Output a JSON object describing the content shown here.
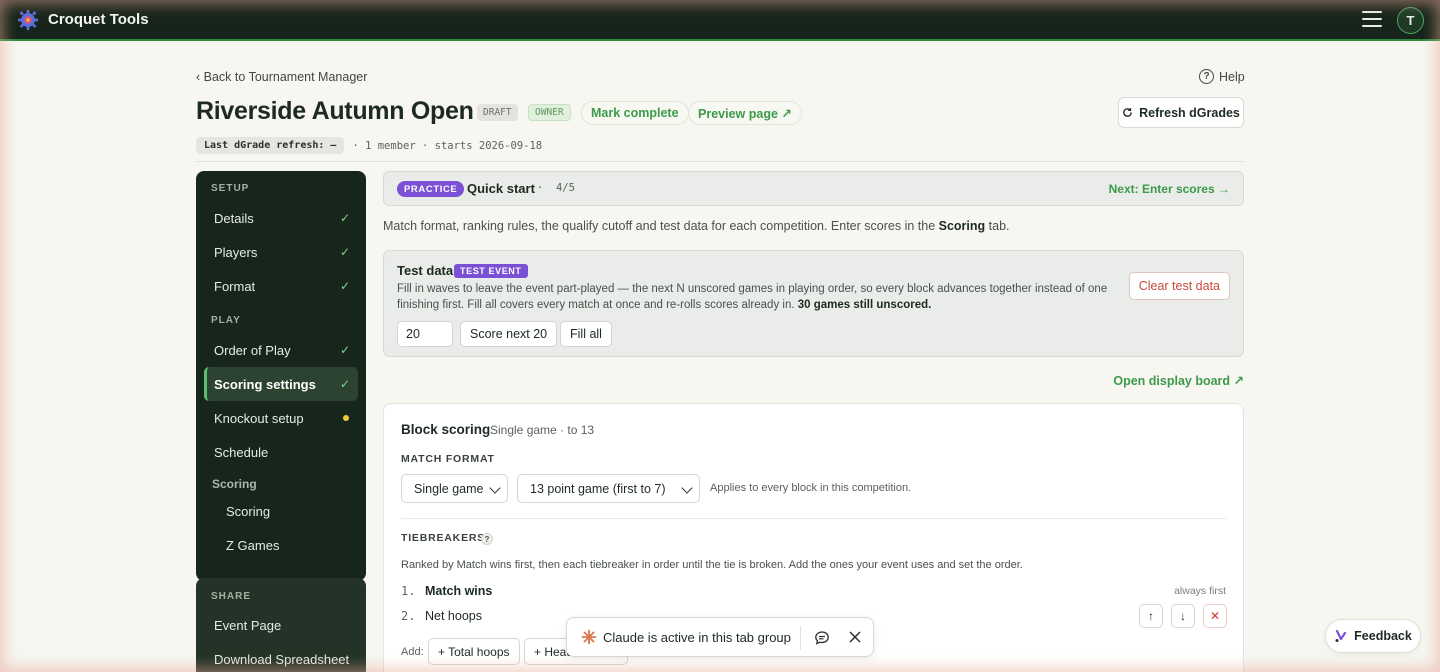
{
  "app": {
    "title": "Croquet Tools",
    "avatar_initial": "T"
  },
  "header": {
    "back_link": "‹ Back to Tournament Manager",
    "help": "Help",
    "title": "Riverside Autumn Open",
    "badge_draft": "DRAFT",
    "badge_owner": "OWNER",
    "mark_complete": "Mark complete",
    "preview_page": "Preview page ↗",
    "refresh_button": "Refresh dGrades",
    "meta_chip": "Last dGrade refresh: —",
    "meta_text": "· 1 member · starts 2026-09-18"
  },
  "sidebar": {
    "setup_label": "SETUP",
    "play_label": "PLAY",
    "share_label": "SHARE",
    "items": [
      {
        "label": "Details",
        "status": "✓"
      },
      {
        "label": "Players",
        "status": "✓"
      },
      {
        "label": "Format",
        "status": "✓"
      },
      {
        "label": "Order of Play",
        "status": "✓"
      },
      {
        "label": "Scoring settings",
        "status": "✓"
      },
      {
        "label": "Knockout setup",
        "status": "pending"
      },
      {
        "label": "Schedule",
        "status": ""
      }
    ],
    "scoring_group": "Scoring",
    "scoring_children": [
      "Scoring",
      "Z Games"
    ],
    "share_items": [
      "Event Page",
      "Download Spreadsheet"
    ]
  },
  "quick_start": {
    "tag": "PRACTICE",
    "title": "Quick start",
    "separator": "·",
    "progress": "4/5",
    "next": "Next: Enter scores →"
  },
  "intro": {
    "before": "Match format, ranking rules, the qualify cutoff and test data for each competition. Enter scores in the ",
    "bold": "Scoring",
    "after": " tab."
  },
  "test_data": {
    "title": "Test data",
    "tag": "TEST EVENT",
    "desc": "Fill in waves to leave the event part-played — the next N unscored games in playing order, so every block advances together instead of one finishing first. Fill all covers every match at once and re-rolls scores already in. ",
    "desc_bold": "30 games still unscored.",
    "input_value": "20",
    "score_next": "Score next 20",
    "fill_all": "Fill all",
    "clear": "Clear test data"
  },
  "display_board": "Open display board ↗",
  "block_scoring": {
    "title": "Block scoring",
    "subtitle": "Single game · to 13",
    "match_format_label": "MATCH FORMAT",
    "format_select": "Single game",
    "points_select": "13 point game (first to 7)",
    "applies_text": "Applies to every block in this competition.",
    "tiebreakers_label": "TIEBREAKERS",
    "tiebreakers_help": "?",
    "tiebreakers_desc": "Ranked by Match wins first, then each tiebreaker in order until the tie is broken. Add the ones your event uses and set the order.",
    "tiebreakers": [
      {
        "num": "1.",
        "name": "Match wins",
        "note": "always first"
      },
      {
        "num": "2.",
        "name": "Net hoops"
      }
    ],
    "add_label": "Add:",
    "add_buttons": [
      "+ Total hoops",
      "+ Head"
    ]
  },
  "claude_bar": {
    "text": "Claude is active in this tab group"
  },
  "feedback": {
    "label": "Feedback"
  },
  "colors": {
    "brand": "#17241b",
    "accent": "#3d9a4b",
    "practice": "#7b4fd6",
    "danger": "#d23b32"
  }
}
